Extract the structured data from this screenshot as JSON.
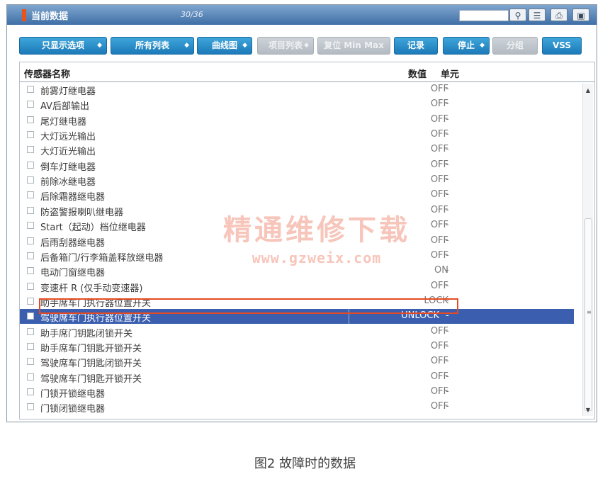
{
  "window": {
    "title": "当前数据",
    "count": "30/36"
  },
  "toolbar": {
    "buttons": [
      {
        "label": "只显示选项",
        "dropdown": true,
        "enabled": true
      },
      {
        "label": "所有列表",
        "dropdown": true,
        "enabled": true
      },
      {
        "label": "曲线图",
        "dropdown": true,
        "enabled": true
      },
      {
        "label": "项目列表",
        "dropdown": true,
        "enabled": false
      },
      {
        "label": "复位 Min Max",
        "dropdown": false,
        "enabled": false
      },
      {
        "label": "记录",
        "dropdown": false,
        "enabled": true
      },
      {
        "label": "停止",
        "dropdown": true,
        "enabled": true
      },
      {
        "label": "分组",
        "dropdown": false,
        "enabled": false
      },
      {
        "label": "VSS",
        "dropdown": false,
        "enabled": true
      }
    ],
    "icons": [
      "search-icon",
      "list-icon",
      "printer-icon",
      "window-icon"
    ]
  },
  "table": {
    "headers": {
      "name": "传感器名称",
      "value": "数值",
      "unit": "单元"
    },
    "rows": [
      {
        "name": "前雾灯继电器",
        "value": "OFF",
        "unit": "-"
      },
      {
        "name": "AV后部输出",
        "value": "OFF",
        "unit": "-"
      },
      {
        "name": "尾灯继电器",
        "value": "OFF",
        "unit": "-"
      },
      {
        "name": "大灯远光输出",
        "value": "OFF",
        "unit": "-"
      },
      {
        "name": "大灯近光输出",
        "value": "OFF",
        "unit": "-"
      },
      {
        "name": "倒车灯继电器",
        "value": "OFF",
        "unit": "-"
      },
      {
        "name": "前除冰继电器",
        "value": "OFF",
        "unit": "-"
      },
      {
        "name": "后除霜器继电器",
        "value": "OFF",
        "unit": "-"
      },
      {
        "name": "防盗警报喇叭继电器",
        "value": "OFF",
        "unit": "-"
      },
      {
        "name": "Start（起动）档位继电器",
        "value": "OFF",
        "unit": "-"
      },
      {
        "name": "后雨刮器继电器",
        "value": "OFF",
        "unit": "-"
      },
      {
        "name": "后备箱门/行李箱盖释放继电器",
        "value": "OFF",
        "unit": "-"
      },
      {
        "name": "电动门窗继电器",
        "value": "ON",
        "unit": "-"
      },
      {
        "name": "变速杆 R (仅手动变速器)",
        "value": "OFF",
        "unit": "-"
      },
      {
        "name": "助手席车门执行器位置开关",
        "value": "LOCK",
        "unit": "-"
      },
      {
        "name": "驾驶席车门执行器位置开关",
        "value": "UNLOCK",
        "unit": "-"
      },
      {
        "name": "助手席门钥匙闭锁开关",
        "value": "OFF",
        "unit": "-"
      },
      {
        "name": "助手席车门钥匙开锁开关",
        "value": "OFF",
        "unit": "-"
      },
      {
        "name": "驾驶席车门钥匙闭锁开关",
        "value": "OFF",
        "unit": "-"
      },
      {
        "name": "驾驶席车门钥匙开锁开关",
        "value": "OFF",
        "unit": "-"
      },
      {
        "name": "门锁开锁继电器",
        "value": "OFF",
        "unit": "-"
      },
      {
        "name": "门锁闭锁继电器",
        "value": "OFF",
        "unit": "-"
      }
    ],
    "selected_row": 15,
    "highlighted_row": 14
  },
  "watermark": {
    "text": "精通维修下载",
    "url": "www.gzweix.com"
  },
  "caption": "图2 故障时的数据",
  "colors": {
    "accent": "#1c7ab8",
    "selected": "#3b5fae",
    "highlight": "#e64a23",
    "title_accent": "#e8541a"
  }
}
